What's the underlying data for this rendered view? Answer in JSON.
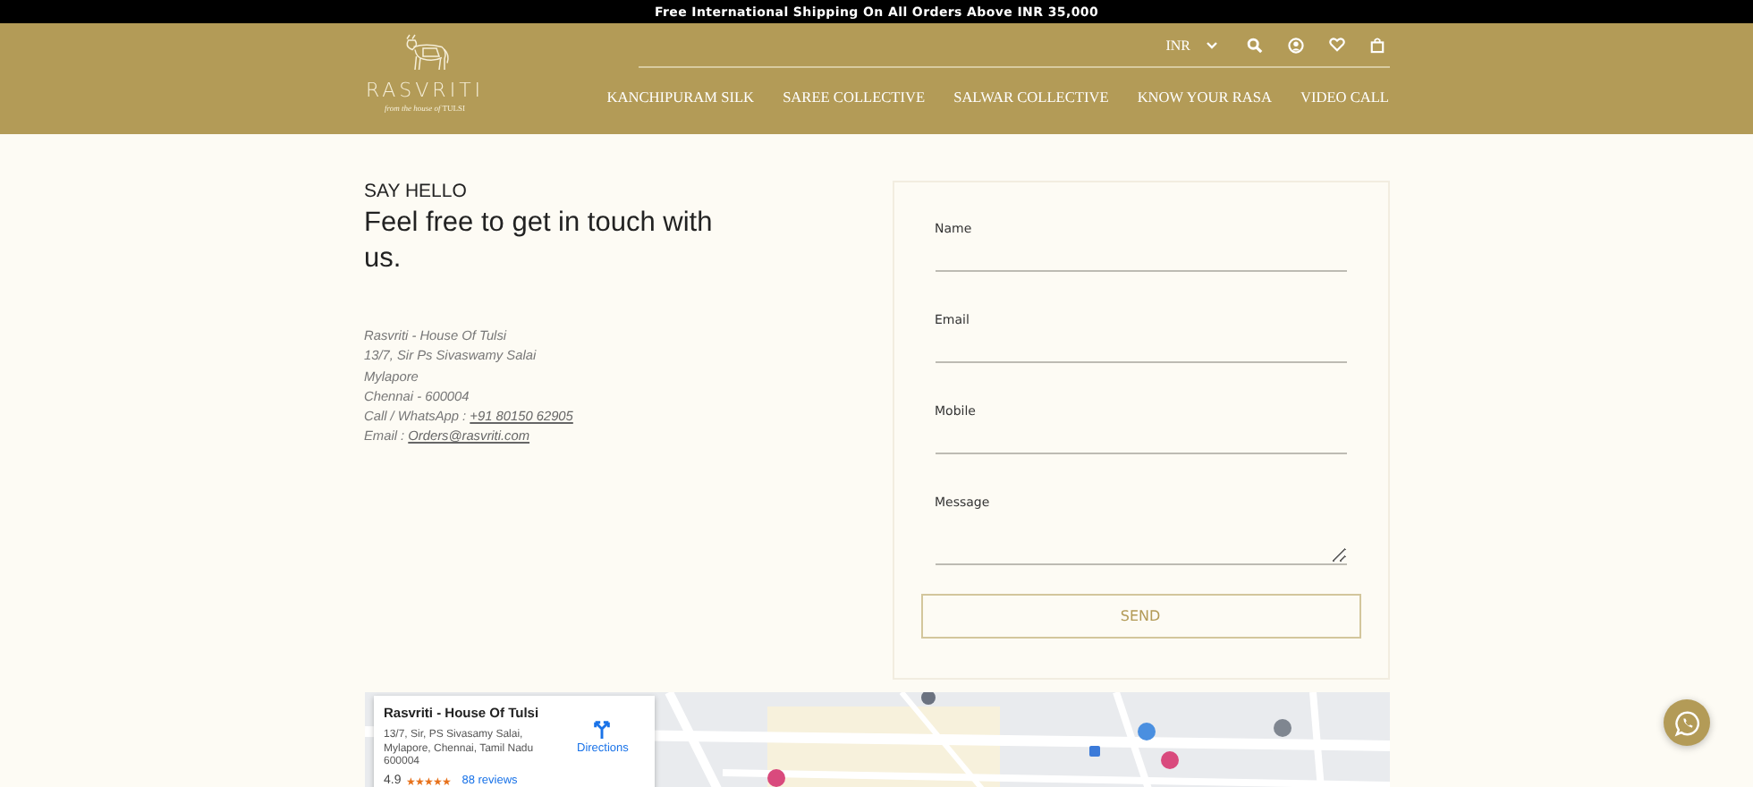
{
  "announcement": "Free International Shipping On All Orders Above INR 35,000",
  "header": {
    "logo": {
      "name": "RASVRITI",
      "tagline": "*from the house of* TULSI"
    },
    "currency": "INR",
    "nav": [
      "KANCHIPURAM SILK",
      "SAREE COLLECTIVE",
      "SALWAR COLLECTIVE",
      "KNOW YOUR RASA",
      "VIDEO CALL"
    ]
  },
  "contact": {
    "eyebrow": "SAY HELLO",
    "heading": "Feel free to get in touch with us.",
    "address_lines": [
      "Rasvriti - House Of Tulsi",
      "13/7, Sir Ps Sivaswamy Salai",
      "Mylapore",
      "Chennai - 600004"
    ],
    "phone": {
      "label": "Call / WhatsApp : ",
      "link": "+91 80150 62905"
    },
    "email": {
      "label": "Email : ",
      "link": "Orders@rasvriti.com"
    }
  },
  "form": {
    "fields": [
      {
        "label": "Name",
        "kind": "line"
      },
      {
        "label": "Email",
        "kind": "line"
      },
      {
        "label": "Mobile",
        "kind": "line"
      },
      {
        "label": "Message",
        "kind": "textarea"
      }
    ],
    "button": "SEND"
  },
  "map": {
    "card": {
      "title": "Rasvriti - House Of Tulsi",
      "address": "13/7, Sir, PS Sivasamy Salai, Mylapore, Chennai, Tamil Nadu 600004",
      "directions": "Directions",
      "rating": "4.9",
      "stars": 5,
      "reviews": "88 reviews"
    }
  }
}
